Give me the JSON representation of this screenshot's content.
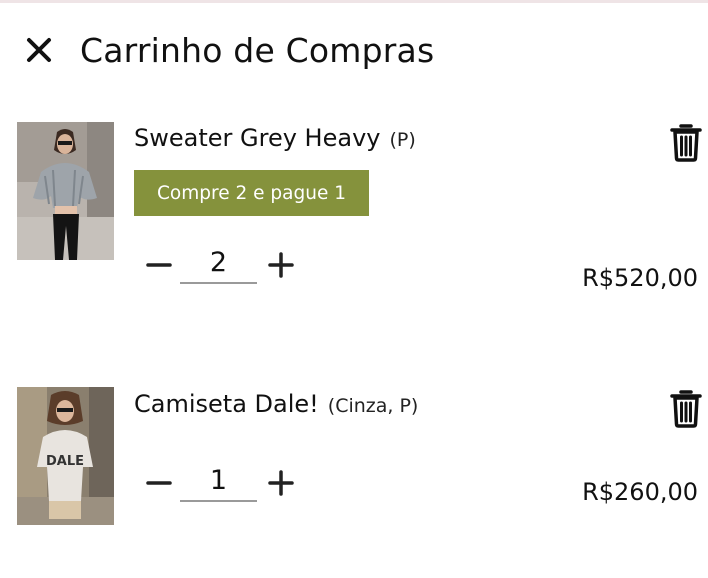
{
  "header": {
    "title": "Carrinho de Compras",
    "close_icon": "close-icon"
  },
  "colors": {
    "promo_background": "#85923c",
    "promo_text": "#ffffff",
    "top_strip": "#efe4e6"
  },
  "items": [
    {
      "name": "Sweater Grey Heavy",
      "variant": "(P)",
      "promo": "Compre 2 e pague 1",
      "quantity": "2",
      "price": "R$520,00",
      "image": "woman-in-grey-knit-sweater-photo"
    },
    {
      "name": "Camiseta Dale!",
      "variant": "(Cinza, P)",
      "quantity": "1",
      "price": "R$260,00",
      "image": "woman-in-grey-dale-tshirt-photo"
    }
  ]
}
